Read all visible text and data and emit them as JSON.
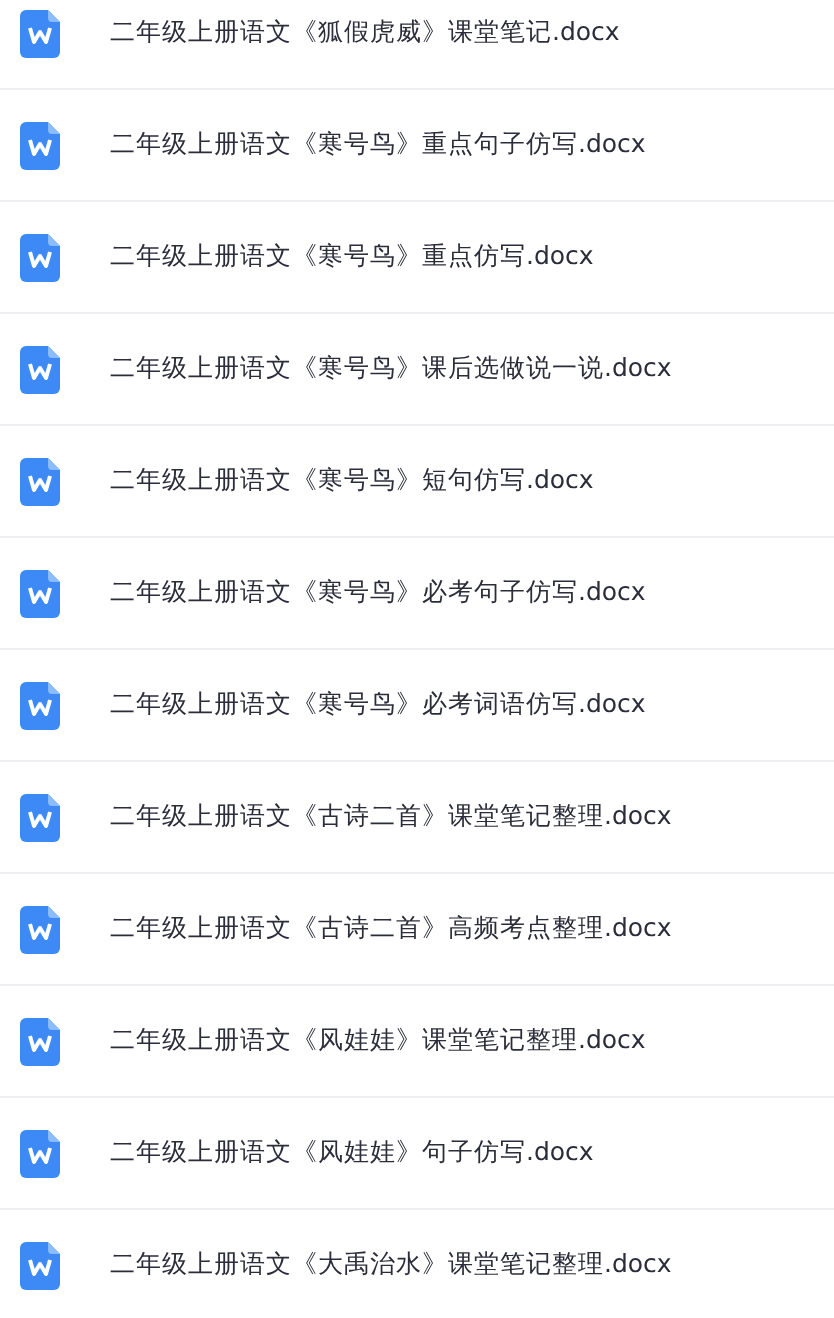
{
  "files": [
    {
      "name": "二年级上册语文《狐假虎威》课堂笔记.docx"
    },
    {
      "name": "二年级上册语文《寒号鸟》重点句子仿写.docx"
    },
    {
      "name": "二年级上册语文《寒号鸟》重点仿写.docx"
    },
    {
      "name": "二年级上册语文《寒号鸟》课后选做说一说.docx"
    },
    {
      "name": "二年级上册语文《寒号鸟》短句仿写.docx"
    },
    {
      "name": "二年级上册语文《寒号鸟》必考句子仿写.docx"
    },
    {
      "name": "二年级上册语文《寒号鸟》必考词语仿写.docx"
    },
    {
      "name": "二年级上册语文《古诗二首》课堂笔记整理.docx"
    },
    {
      "name": "二年级上册语文《古诗二首》高频考点整理.docx"
    },
    {
      "name": "二年级上册语文《风娃娃》课堂笔记整理.docx"
    },
    {
      "name": "二年级上册语文《风娃娃》句子仿写.docx"
    },
    {
      "name": "二年级上册语文《大禹治水》课堂笔记整理.docx"
    }
  ]
}
